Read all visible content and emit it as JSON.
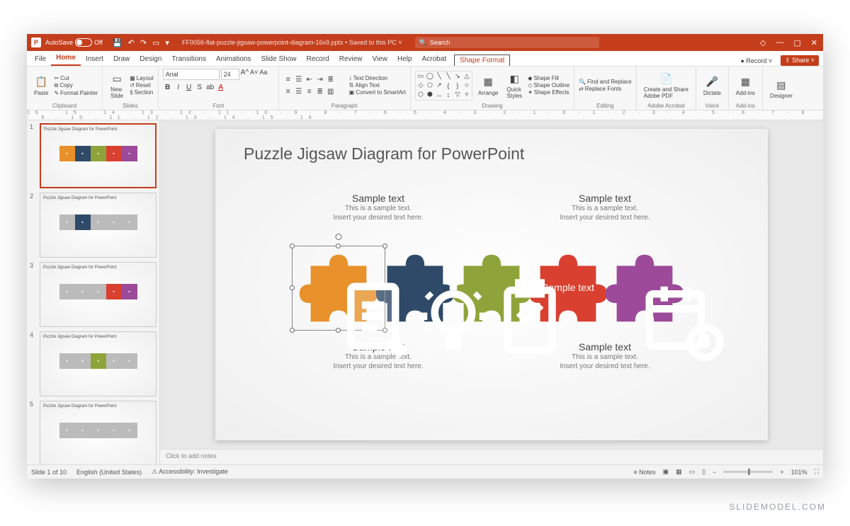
{
  "titlebar": {
    "autosave_label": "AutoSave",
    "autosave_state": "Off",
    "filename": "FF0056-flat-puzzle-jigsaw-powerpoint-diagram-16x9.pptx",
    "saved_status": "Saved to this PC",
    "search_placeholder": "Search"
  },
  "tabs": [
    "File",
    "Home",
    "Insert",
    "Draw",
    "Design",
    "Transitions",
    "Animations",
    "Slide Show",
    "Record",
    "Review",
    "View",
    "Help",
    "Acrobat"
  ],
  "contextual_tab": "Shape Format",
  "active_tab": "Home",
  "record_btn": "Record",
  "share_btn": "Share",
  "ribbon": {
    "clipboard": {
      "paste": "Paste",
      "cut": "Cut",
      "copy": "Copy",
      "format_painter": "Format Painter",
      "label": "Clipboard"
    },
    "slides": {
      "new_slide": "New\nSlide",
      "layout": "Layout",
      "reset": "Reset",
      "section": "Section",
      "label": "Slides"
    },
    "font": {
      "name": "Arial",
      "size": "24",
      "label": "Font"
    },
    "paragraph": {
      "text_direction": "Text Direction",
      "align_text": "Align Text",
      "smartart": "Convert to SmartArt",
      "label": "Paragraph"
    },
    "drawing": {
      "arrange": "Arrange",
      "quick_styles": "Quick\nStyles",
      "shape_fill": "Shape Fill",
      "shape_outline": "Shape Outline",
      "shape_effects": "Shape Effects",
      "label": "Drawing"
    },
    "editing": {
      "find": "Find and Replace",
      "replace_fonts": "Replace Fonts",
      "label": "Editing"
    },
    "adobe": {
      "btn": "Create and Share\nAdobe PDF",
      "label": "Adobe Acrobat"
    },
    "voice": {
      "dictate": "Dictate",
      "label": "Voice"
    },
    "addins": {
      "btn": "Add-ins",
      "label": "Add-ins"
    },
    "designer": {
      "btn": "Designer"
    }
  },
  "ruler_marks": "16 · 15 · 14 · 13 · 12 · 11 · 10 · 9 · 8 · 7 · 6 · 5 · 4 · 3 · 2 · 1 · 0 · 1 · 2 · 3 · 4 · 5 · 6 · 7 · 8 · 9 · 10 · 11 · 12 · 13 · 14 · 15 · 16",
  "thumb_title": "Puzzle Jigsaw Diagram for PowerPoint",
  "thumb_count": 5,
  "slide": {
    "title": "Puzzle Jigsaw Diagram for PowerPoint",
    "captions": {
      "heading": "Sample text",
      "line1": "This is a sample text.",
      "line2": "Insert your desired text here."
    },
    "pieces": [
      {
        "color": "#e8912a",
        "icon": "document"
      },
      {
        "color": "#2f4a68",
        "icon": "bulb"
      },
      {
        "color": "#8ea43a",
        "icon": "clipboard"
      },
      {
        "color": "#d9402f",
        "label": "Sample\ntext"
      },
      {
        "color": "#9c4a99",
        "icon": "calendar"
      }
    ]
  },
  "notes_placeholder": "Click to add notes",
  "status": {
    "slide": "Slide 1 of 10",
    "lang": "English (United States)",
    "access": "Accessibility: Investigate",
    "notes": "Notes",
    "zoom": "101%"
  },
  "watermark": "SLIDEMODEL.COM"
}
